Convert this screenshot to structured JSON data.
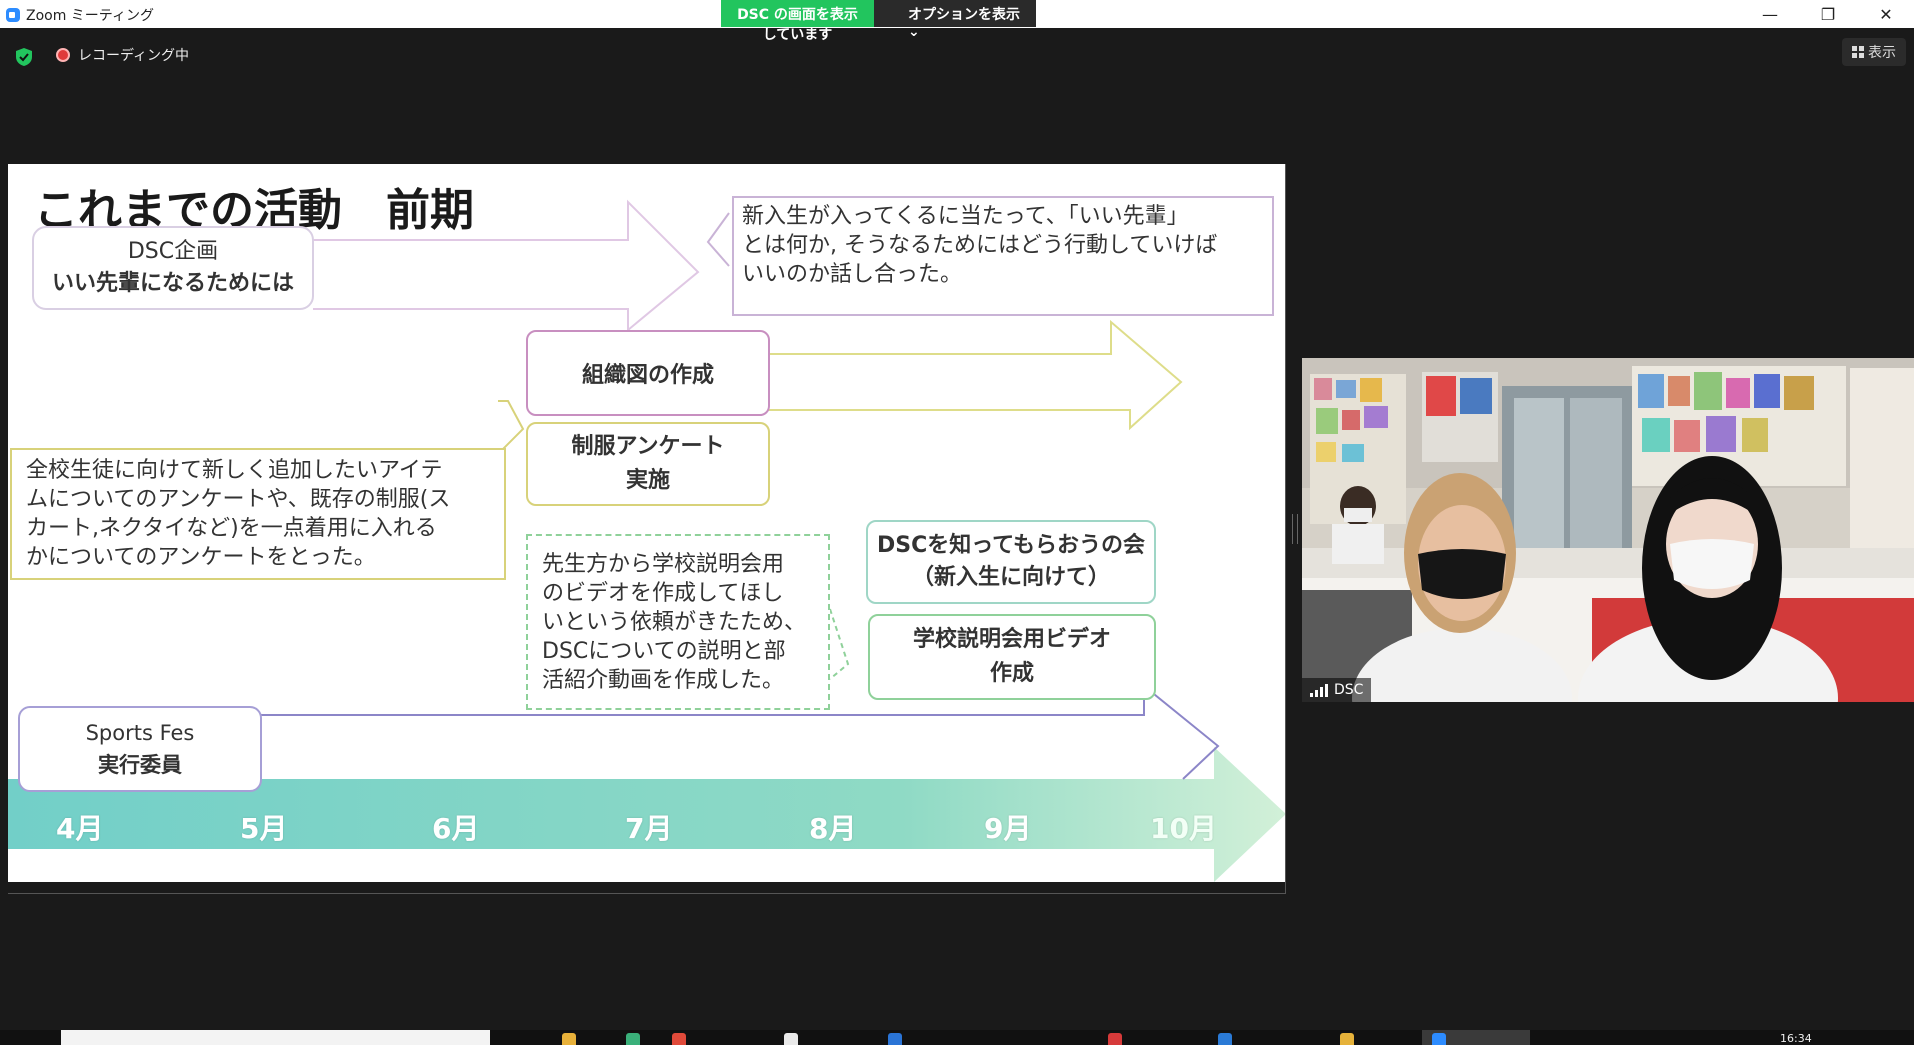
{
  "window": {
    "title": "Zoom ミーティング",
    "minimize": "—",
    "maximize": "❐",
    "close": "✕"
  },
  "share_banner": {
    "status": "DSC の画面を表示しています",
    "options": "オプションを表示 ⌄"
  },
  "meeting": {
    "recording_label": "レコーディング中",
    "view_button": "表示"
  },
  "slide": {
    "title": "これまでの活動　前期",
    "dsc_plan_line1": "DSC企画",
    "dsc_plan_line2": "いい先輩になるためには",
    "senior_note_lines": [
      "新入生が入ってくるに当たって、「いい先輩」",
      "とは何か, そうなるためにはどう行動していけば",
      "いいのか話し合った。"
    ],
    "org_chart": "組織図の作成",
    "uniform_survey_line1": "制服アンケート",
    "uniform_survey_line2": "実施",
    "uniform_note_lines": [
      "全校生徒に向けて新しく追加したいアイテ",
      "ムについてのアンケートや、既存の制服(ス",
      "カート,ネクタイなど)を一点着用に入れる",
      "かについてのアンケートをとった。"
    ],
    "video_note_lines": [
      "先生方から学校説明会用",
      "のビデオを作成してほし",
      "いという依頼がきたため、",
      "DSCについての説明と部",
      "活紹介動画を作成した。"
    ],
    "know_dsc_line1": "DSCを知ってもらおうの会",
    "know_dsc_line2": "（新入生に向けて）",
    "school_video_line1": "学校説明会用ビデオ",
    "school_video_line2": "作成",
    "sports_line1": "Sports Fes",
    "sports_line2": "実行委員",
    "months": [
      "4月",
      "5月",
      "6月",
      "7月",
      "8月",
      "9月",
      "10月"
    ]
  },
  "participant": {
    "name": "DSC"
  },
  "taskbar": {
    "clock": "16:34"
  },
  "colors": {
    "share_green": "#22c55e",
    "timeline_teal": "#7fd3cc",
    "pink_border": "#c88fc0",
    "yellow_border": "#d8d27a",
    "green_border": "#8fd19a",
    "purple_line": "#8c86c8",
    "gray_purple_border": "#b8a9c9"
  }
}
